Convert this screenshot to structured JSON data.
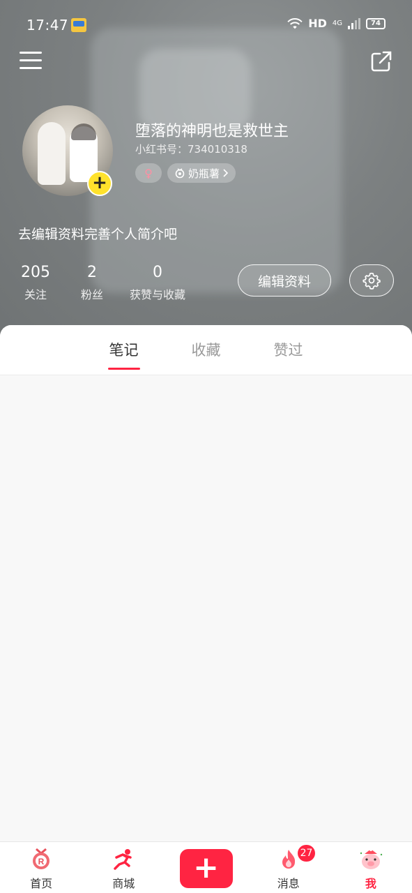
{
  "status_bar": {
    "time": "17:47",
    "network": "HD",
    "cell_type": "4G",
    "battery": "74"
  },
  "header": {
    "menu_icon": "hamburger-menu-icon",
    "share_icon": "share-external-icon"
  },
  "profile": {
    "username": "堕落的神明也是救世主",
    "user_id_label": "小红书号：",
    "user_id": "734010318",
    "gender_symbol": "♀",
    "zodiac_tag": "奶瓶薯",
    "bio": "去编辑资料完善个人简介吧",
    "avatar_add_symbol": "+"
  },
  "stats": [
    {
      "num": "205",
      "label": "关注"
    },
    {
      "num": "2",
      "label": "粉丝"
    },
    {
      "num": "0",
      "label": "获赞与收藏"
    }
  ],
  "actions": {
    "edit_label": "编辑资料",
    "settings_icon": "gear-icon"
  },
  "tabs": [
    {
      "label": "笔记",
      "active": true
    },
    {
      "label": "收藏",
      "active": false
    },
    {
      "label": "赞过",
      "active": false
    }
  ],
  "bottom_nav": {
    "home": "首页",
    "mall": "商城",
    "publish": "+",
    "messages": "消息",
    "messages_badge": "27",
    "me": "我"
  },
  "colors": {
    "accent": "#ff2442",
    "avatar_add": "#ffe22c"
  }
}
